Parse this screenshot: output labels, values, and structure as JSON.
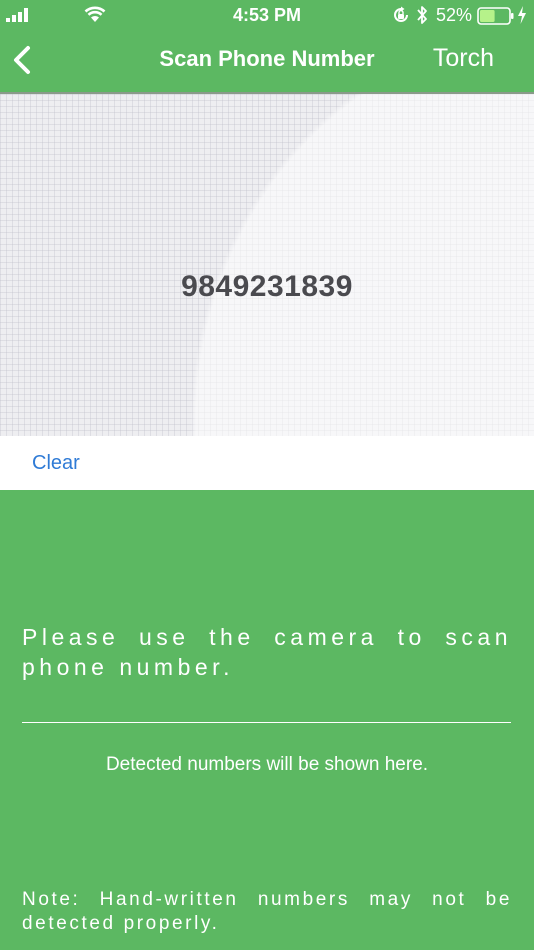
{
  "status_bar": {
    "time": "4:53 PM",
    "battery_percent": "52%",
    "battery_level": 0.52,
    "icons": [
      "signal-icon",
      "wifi-icon",
      "rotation-lock-icon",
      "bluetooth-icon",
      "battery-icon",
      "charging-icon"
    ]
  },
  "nav": {
    "back_icon": "chevron-left-icon",
    "title": "Scan Phone Number",
    "torch_label": "Torch"
  },
  "camera": {
    "scanned_text": "9849231839"
  },
  "actions": {
    "clear_label": "Clear"
  },
  "info": {
    "instruction": "Please use the camera to scan phone number.",
    "detected_placeholder": "Detected numbers will be shown here.",
    "note": "Note: Hand-written numbers may not be detected properly."
  },
  "colors": {
    "primary_green": "#5cb862",
    "link_blue": "#2f7bd6",
    "scanned_text": "#4a4a4f"
  }
}
